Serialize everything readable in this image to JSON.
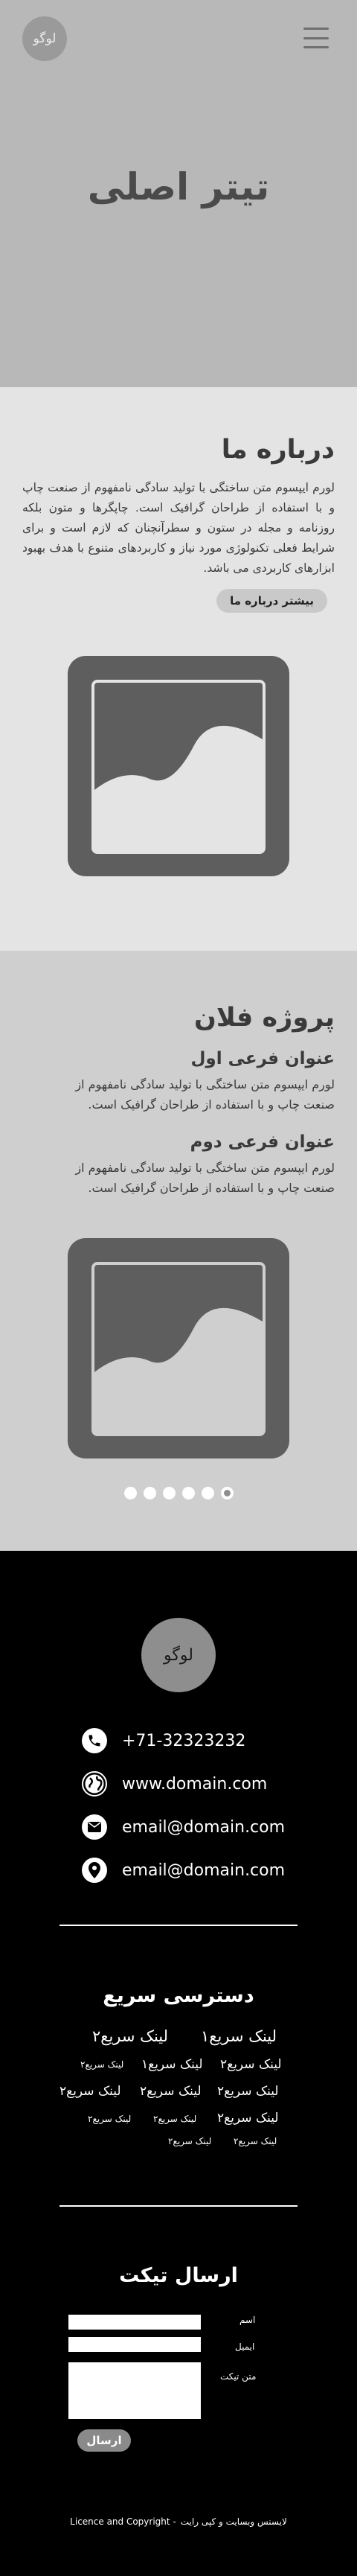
{
  "header": {
    "logo_text": "لوگو",
    "hero_title": "تیتر اصلی"
  },
  "about": {
    "title": "درباره ما",
    "text": "لورم ایپسوم متن ساختگی با تولید سادگی نامفهوم از صنعت چاپ و با استفاده از طراحان گرافیک است. چاپگرها و متون بلکه روزنامه و مجله در ستون و سطرآنچنان که لازم است و برای شرایط فعلی تکنولوژی مورد نیاز و کاربردهای متنوع با هدف بهبود ابزارهای کاربردی می باشد.",
    "button_label": "بیشتر درباره ما"
  },
  "project": {
    "title": "پروژه فلان",
    "items": [
      {
        "title": "عنوان فرعی اول",
        "text": "لورم ایپسوم متن ساختگی با تولید سادگی نامفهوم از صنعت چاپ و با استفاده از طراحان گرافیک است."
      },
      {
        "title": "عنوان فرعی دوم",
        "text": "لورم ایپسوم متن ساختگی با تولید سادگی نامفهوم از صنعت چاپ و با استفاده از طراحان گرافیک است."
      }
    ],
    "slider_total": 6,
    "slider_active": 6
  },
  "footer": {
    "logo_text": "لوگو",
    "contacts": [
      {
        "icon": "phone-icon",
        "text": "+71-32323232"
      },
      {
        "icon": "globe-icon",
        "text": "www.domain.com"
      },
      {
        "icon": "mail-icon",
        "text": "email@domain.com"
      },
      {
        "icon": "location-icon",
        "text": "email@domain.com"
      }
    ],
    "quick_access": {
      "title": "دسترسی سریع",
      "links": {
        "lg1": "لینک سریع۱",
        "lg2": "لینک سریع۲",
        "md1": "لینک سریع۱",
        "md2": "لینک سریع۲",
        "md3": "لینک سریع۲",
        "md4": "لینک سریع۲",
        "md5": "لینک سریع۲",
        "md6": "لینک سریع۲",
        "sm1": "لینک سریع۲",
        "sm2": "لینک سریع۲",
        "sm3": "لینک سریع۲",
        "sm4": "لینک سریع۲",
        "sm5": "لینک سریع۲",
        "sm6": "لینک سریع۲"
      }
    },
    "ticket": {
      "title": "ارسال تیکت",
      "name_label": "اسم",
      "email_label": "ایمیل",
      "message_label": "متن تیکت",
      "send_label": "ارسال"
    },
    "copyright": {
      "fa": "لایسنس وبسایت و کپی رایت",
      "en": "Licence and Copyright -"
    }
  }
}
